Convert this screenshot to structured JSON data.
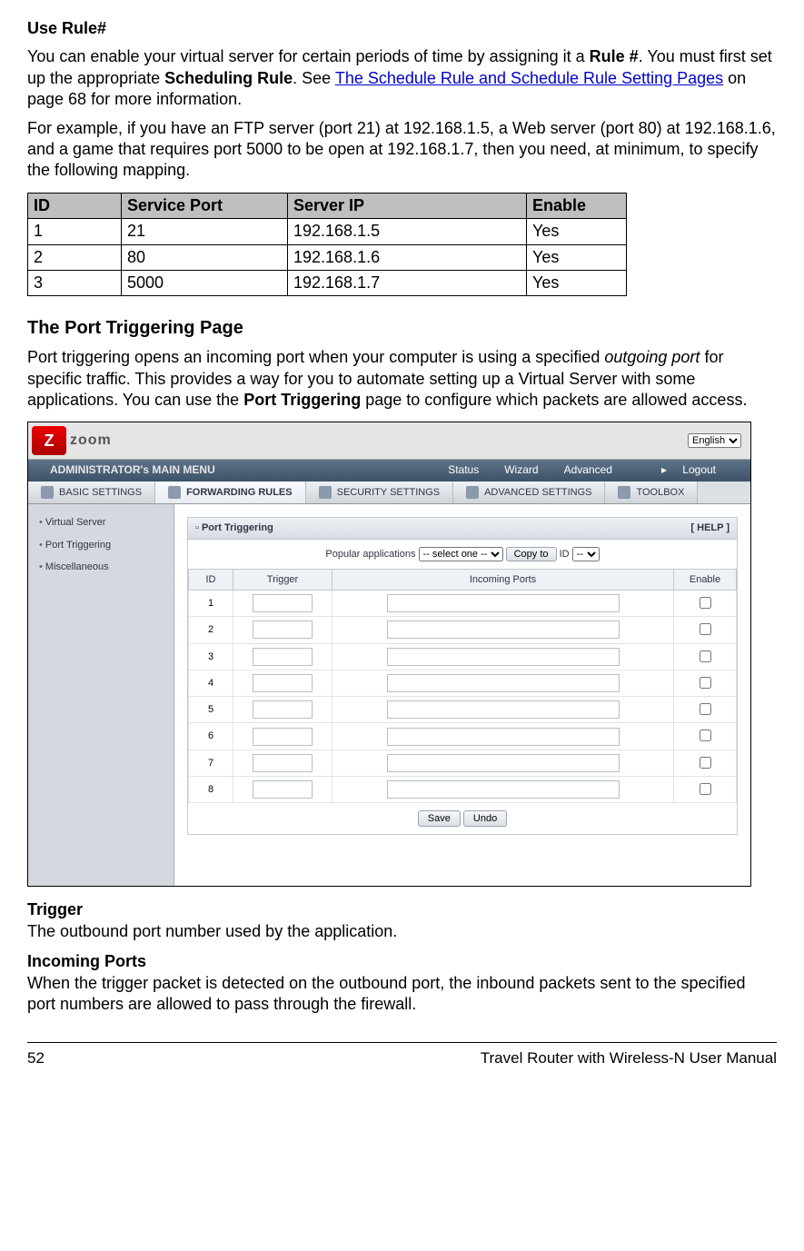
{
  "headings": {
    "use_rule": "Use Rule#",
    "port_triggering": "The Port Triggering Page",
    "trigger": "Trigger",
    "incoming_ports": "Incoming Ports"
  },
  "paragraphs": {
    "use_rule_1a": "You can enable your virtual server for certain periods of time by assigning it a ",
    "use_rule_1b": ". You must first set up the appropriate ",
    "use_rule_1c": ". See ",
    "use_rule_link": "The Schedule Rule and Schedule Rule Setting Pages",
    "use_rule_1d": " on page 68 for more information.",
    "rule_num": "Rule #",
    "sched_rule": "Scheduling Rule",
    "example": "For example, if you have an FTP server (port 21) at 192.168.1.5, a Web server (port 80) at 192.168.1.6, and a game that requires port 5000 to be open at 192.168.1.7, then you need, at minimum, to specify the following mapping.",
    "pt_desc_1": "Port triggering opens an incoming port when your computer is using a specified ",
    "pt_desc_italic": "outgoing port",
    "pt_desc_2": " for specific traffic. This provides a way for you to automate setting up a Virtual Server with some applications. You can use the ",
    "pt_desc_ui": "Port Triggering",
    "pt_desc_3": " page to configure which packets are allowed access.",
    "trigger_desc": "The outbound port number used by the application.",
    "incoming_desc": "When the trigger packet is detected on the outbound port, the inbound packets sent to the specified port numbers are allowed to pass through the firewall."
  },
  "table": {
    "headers": {
      "id": "ID",
      "port": "Service Port",
      "ip": "Server IP",
      "enable": "Enable"
    },
    "rows": [
      {
        "id": "1",
        "port": "21",
        "ip": "192.168.1.5",
        "enable": "Yes"
      },
      {
        "id": "2",
        "port": "80",
        "ip": "192.168.1.6",
        "enable": "Yes"
      },
      {
        "id": "3",
        "port": "5000",
        "ip": "192.168.1.7",
        "enable": "Yes"
      }
    ]
  },
  "screenshot": {
    "logo_text": "zoom",
    "lang": "English",
    "admin_menu": "ADMINISTRATOR's MAIN MENU",
    "top_nav": {
      "status": "Status",
      "wizard": "Wizard",
      "advanced": "Advanced",
      "logout": "Logout"
    },
    "tabs": {
      "basic": "BASIC SETTINGS",
      "forwarding": "FORWARDING RULES",
      "security": "SECURITY SETTINGS",
      "advanced": "ADVANCED SETTINGS",
      "toolbox": "TOOLBOX"
    },
    "sidebar": {
      "virtual_server": "Virtual Server",
      "port_triggering": "Port Triggering",
      "misc": "Miscellaneous"
    },
    "panel": {
      "title": "Port Triggering",
      "help": "[ HELP ]",
      "popular_label": "Popular applications",
      "select_one": "-- select one --",
      "copy_to": "Copy to",
      "id_label": "ID",
      "id_select": "--",
      "cols": {
        "id": "ID",
        "trigger": "Trigger",
        "incoming": "Incoming Ports",
        "enable": "Enable"
      },
      "row_ids": [
        "1",
        "2",
        "3",
        "4",
        "5",
        "6",
        "7",
        "8"
      ],
      "save": "Save",
      "undo": "Undo"
    }
  },
  "footer": {
    "page": "52",
    "title": "Travel Router with Wireless-N User Manual"
  }
}
